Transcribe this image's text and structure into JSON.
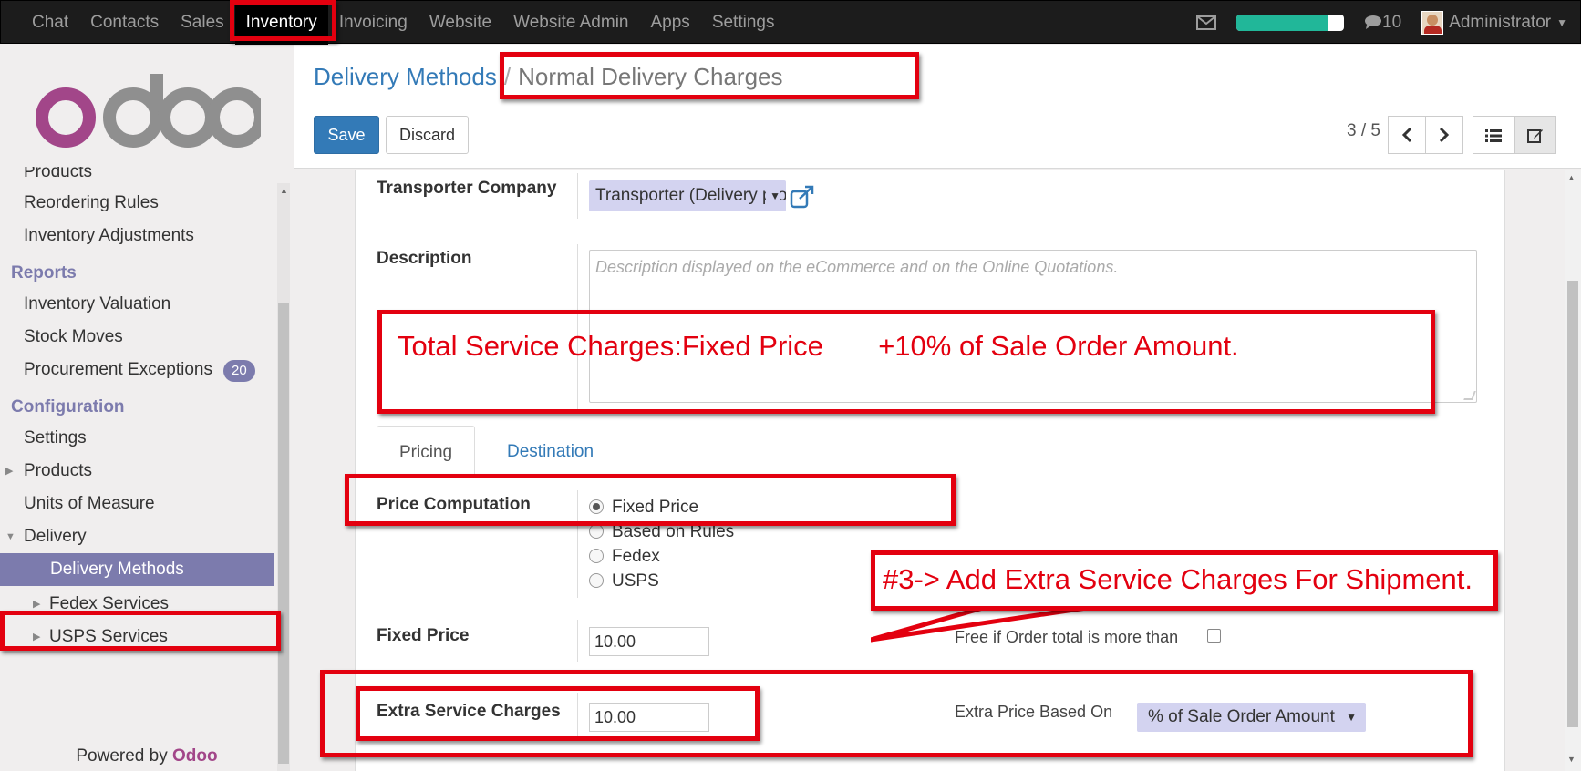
{
  "topbar": {
    "menu": [
      "Chat",
      "Contacts",
      "Sales",
      "Inventory",
      "Invoicing",
      "Website",
      "Website Admin",
      "Apps",
      "Settings"
    ],
    "active": "Inventory",
    "progress_percent": 85,
    "messages_count": "10",
    "user": "Administrator"
  },
  "sidebar": {
    "logo_text": "odoo",
    "items": {
      "products_top": "Products",
      "reordering_rules": "Reordering Rules",
      "inventory_adjustments": "Inventory Adjustments",
      "reports_header": "Reports",
      "inventory_valuation": "Inventory Valuation",
      "stock_moves": "Stock Moves",
      "procurement_exceptions": "Procurement Exceptions",
      "procurement_badge": "20",
      "configuration_header": "Configuration",
      "settings": "Settings",
      "products": "Products",
      "units_of_measure": "Units of Measure",
      "delivery": "Delivery",
      "delivery_methods": "Delivery Methods",
      "fedex_services": "Fedex Services",
      "usps_services": "USPS Services"
    },
    "powered_by": "Powered by",
    "powered_brand": "Odoo"
  },
  "control": {
    "breadcrumb_parent": "Delivery Methods",
    "breadcrumb_sep": "/",
    "breadcrumb_current": "Normal Delivery Charges",
    "save": "Save",
    "discard": "Discard",
    "pager": "3 / 5"
  },
  "form": {
    "transporter_label": "Transporter Company",
    "transporter_value": "Transporter (Delivery product)",
    "description_label": "Description",
    "description_placeholder": "Description displayed on the eCommerce and on the Online Quotations.",
    "tabs": [
      "Pricing",
      "Destination"
    ],
    "price_computation_label": "Price Computation",
    "price_options": [
      "Fixed Price",
      "Based on Rules",
      "Fedex",
      "USPS"
    ],
    "price_selected": "Fixed Price",
    "fixed_price_label": "Fixed Price",
    "fixed_price_value": "10.00",
    "free_if_label": "Free if Order total is more than",
    "extra_label": "Extra Service Charges",
    "extra_value": "10.00",
    "extra_based_label": "Extra Price Based On",
    "extra_based_value": "% of Sale Order Amount"
  },
  "annotations": {
    "total_text": "Total Service Charges:Fixed Price       +10% of Sale Order Amount.",
    "callout_text": "#3-> Add Extra Service Charges For Shipment."
  },
  "colors": {
    "annotation_red": "#e3000f",
    "odoo_purple": "#7c7bad",
    "link_blue": "#337ab7"
  }
}
